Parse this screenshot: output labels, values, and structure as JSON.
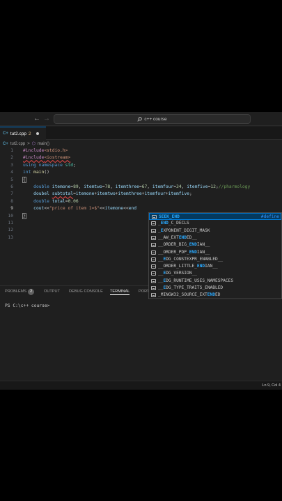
{
  "titlebar": {
    "back": "←",
    "forward": "→",
    "search_text": "c++ course"
  },
  "tab": {
    "icon": "C+",
    "name": "tut2.cpp",
    "status": "2"
  },
  "breadcrumb": {
    "file_icon": "C+",
    "file": "tut2.cpp",
    "separator": ">",
    "fn_icon": "⬡",
    "fn": "main()"
  },
  "editor": {
    "lines": [
      {
        "n": "1",
        "tokens": [
          {
            "t": "#include",
            "c": "pre"
          },
          {
            "t": "<stdio.h>",
            "c": "str"
          }
        ]
      },
      {
        "n": "2",
        "tokens": [
          {
            "t": "#include",
            "c": "pre",
            "sq": true
          },
          {
            "t": "<iostream>",
            "c": "str",
            "sq": true
          }
        ]
      },
      {
        "n": "3",
        "tokens": [
          {
            "t": "using ",
            "c": "kw"
          },
          {
            "t": "namespace ",
            "c": "kw"
          },
          {
            "t": "std",
            "c": "type"
          },
          {
            "t": ";",
            "c": "txt"
          }
        ]
      },
      {
        "n": "4",
        "tokens": [
          {
            "t": "int ",
            "c": "kw"
          },
          {
            "t": "main",
            "c": "fn"
          },
          {
            "t": "()",
            "c": "txt"
          }
        ]
      },
      {
        "n": "5",
        "tokens": [
          {
            "t": "{",
            "c": "txt",
            "box": true
          }
        ]
      },
      {
        "n": "6",
        "tokens": [
          {
            "t": "    ",
            "c": "txt"
          },
          {
            "t": "double ",
            "c": "kw"
          },
          {
            "t": "itemone",
            "c": "var"
          },
          {
            "t": "=",
            "c": "txt"
          },
          {
            "t": "89",
            "c": "num"
          },
          {
            "t": ", ",
            "c": "txt"
          },
          {
            "t": "itemtwo",
            "c": "var"
          },
          {
            "t": "=",
            "c": "txt"
          },
          {
            "t": "78",
            "c": "num"
          },
          {
            "t": ", ",
            "c": "txt"
          },
          {
            "t": "itemthree",
            "c": "var"
          },
          {
            "t": "=",
            "c": "txt"
          },
          {
            "t": "67",
            "c": "num"
          },
          {
            "t": ", ",
            "c": "txt"
          },
          {
            "t": "itemfour",
            "c": "var"
          },
          {
            "t": "=",
            "c": "txt"
          },
          {
            "t": "34",
            "c": "num"
          },
          {
            "t": ", ",
            "c": "txt"
          },
          {
            "t": "itemfive",
            "c": "var"
          },
          {
            "t": "=",
            "c": "txt"
          },
          {
            "t": "12",
            "c": "num"
          },
          {
            "t": ";",
            "c": "txt"
          },
          {
            "t": "//pharmology",
            "c": "com"
          }
        ]
      },
      {
        "n": "7",
        "tokens": [
          {
            "t": "    ",
            "c": "txt"
          },
          {
            "t": "doubel ",
            "c": "var"
          },
          {
            "t": "subtotal",
            "c": "var",
            "sq": true
          },
          {
            "t": "=",
            "c": "txt"
          },
          {
            "t": "itemone",
            "c": "var"
          },
          {
            "t": "+",
            "c": "txt"
          },
          {
            "t": "itemtwo",
            "c": "var"
          },
          {
            "t": "+",
            "c": "txt"
          },
          {
            "t": "itemthree",
            "c": "var"
          },
          {
            "t": "+",
            "c": "txt"
          },
          {
            "t": "itemfour",
            "c": "var"
          },
          {
            "t": "+",
            "c": "txt"
          },
          {
            "t": "itemfive",
            "c": "var"
          },
          {
            "t": ";",
            "c": "txt"
          }
        ]
      },
      {
        "n": "8",
        "tokens": [
          {
            "t": "    ",
            "c": "txt"
          },
          {
            "t": "double ",
            "c": "kw"
          },
          {
            "t": "total",
            "c": "var"
          },
          {
            "t": "=",
            "c": "txt"
          },
          {
            "t": "0.06",
            "c": "num"
          }
        ]
      },
      {
        "n": "9",
        "active": true,
        "tokens": [
          {
            "t": "    ",
            "c": "txt"
          },
          {
            "t": "cout",
            "c": "var"
          },
          {
            "t": "<<",
            "c": "txt"
          },
          {
            "t": "\"price of item 1=$\"",
            "c": "str"
          },
          {
            "t": "<<",
            "c": "txt"
          },
          {
            "t": "itemone",
            "c": "var"
          },
          {
            "t": "<<",
            "c": "txt"
          },
          {
            "t": "end",
            "c": "var"
          }
        ]
      },
      {
        "n": "10",
        "tokens": [
          {
            "t": "}",
            "c": "txt",
            "box": true
          }
        ]
      },
      {
        "n": "11",
        "tokens": []
      },
      {
        "n": "12",
        "tokens": []
      },
      {
        "n": "13",
        "tokens": []
      }
    ]
  },
  "suggestions": {
    "items": [
      {
        "pre": "",
        "hl": "SEEK_END",
        "post": "",
        "detail": "#define",
        "selected": true
      },
      {
        "pre": "_",
        "hl": "END",
        "post": "_C_DECLS",
        "detail": ""
      },
      {
        "pre": "_",
        "hl": "E",
        "post": "XPONENT_DIGIT_MASK",
        "detail": ""
      },
      {
        "pre": "__AW_EXT",
        "hl": "END",
        "post": "ED__",
        "detail": ""
      },
      {
        "pre": "__ORDER_BIG_",
        "hl": "END",
        "post": "IAN__",
        "detail": ""
      },
      {
        "pre": "__ORDER_PDP_",
        "hl": "END",
        "post": "IAN__",
        "detail": ""
      },
      {
        "pre": "__",
        "hl": "E",
        "post": "DG_CONSTEXPR_ENABLED__",
        "detail": ""
      },
      {
        "pre": "__ORDER_LITTLE_",
        "hl": "END",
        "post": "IAN__",
        "detail": ""
      },
      {
        "pre": "__",
        "hl": "E",
        "post": "DG_VERSION__",
        "detail": ""
      },
      {
        "pre": "__",
        "hl": "E",
        "post": "DG_RUNTIME_USES_NAMESPACES",
        "detail": ""
      },
      {
        "pre": "__",
        "hl": "E",
        "post": "DG_TYPE_TRAITS_ENABLED",
        "detail": ""
      },
      {
        "pre": "_MINGW32_SOURCE_EXT",
        "hl": "END",
        "post": "ED",
        "detail": ""
      }
    ]
  },
  "panel": {
    "problems": "PROBLEMS",
    "problems_count": "2",
    "output": "OUTPUT",
    "debug": "DEBUG CONSOLE",
    "terminal": "TERMINAL",
    "ports": "PORTS"
  },
  "terminal": {
    "prompt": "PS C:\\c++ course>"
  },
  "status": {
    "position": "Ln 9, Col 4"
  }
}
